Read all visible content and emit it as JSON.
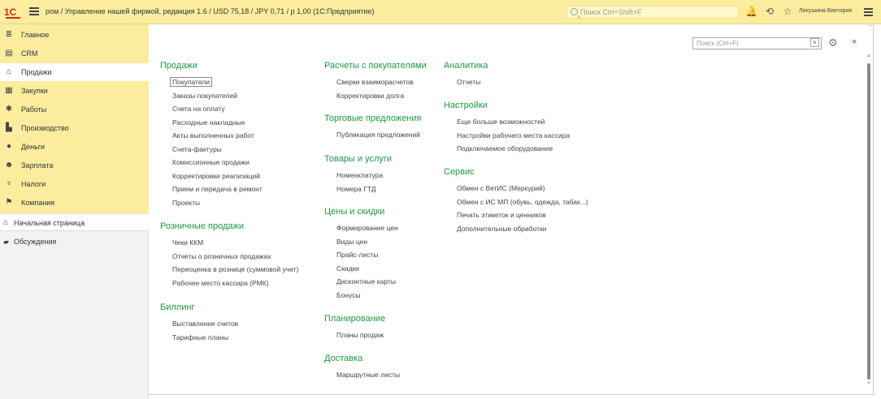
{
  "topbar": {
    "logo": "1С",
    "title": "ром / Управление нашей фирмой, редакция 1.6 / USD 75,18 / JPY 0,71 / р 1,00  (1С:Предприятие)",
    "search_placeholder": "Поиск Ctrl+Shift+F",
    "user": "Лихушина Виктория"
  },
  "sidebar": {
    "items": [
      {
        "label": "Главное",
        "icon": "≣",
        "name": "main"
      },
      {
        "label": "CRM",
        "icon": "▤",
        "name": "crm"
      },
      {
        "label": "Продажи",
        "icon": "⌂",
        "name": "sales"
      },
      {
        "label": "Закупки",
        "icon": "▦",
        "name": "purchases"
      },
      {
        "label": "Работы",
        "icon": "✱",
        "name": "works"
      },
      {
        "label": "Производство",
        "icon": "▙",
        "name": "production"
      },
      {
        "label": "Деньги",
        "icon": "●",
        "name": "money"
      },
      {
        "label": "Зарплата",
        "icon": "☻",
        "name": "salary"
      },
      {
        "label": "Налоги",
        "icon": "♆",
        "name": "taxes"
      },
      {
        "label": "Компания",
        "icon": "⚑",
        "name": "company"
      }
    ],
    "home": "Начальная страница",
    "discussions": "Обсуждения"
  },
  "panel": {
    "search_placeholder": "Поиск (Ctrl+F)",
    "clear": "×",
    "close": "×"
  },
  "sections": {
    "sales": {
      "title": "Продажи",
      "links": [
        "Покупатели",
        "Заказы покупателей",
        "Счета на оплату",
        "Расходные накладные",
        "Акты выполненных работ",
        "Счета-фактуры",
        "Комиссионные продажи",
        "Корректировки реализаций",
        "Прием и передача в ремонт",
        "Проекты"
      ]
    },
    "retail": {
      "title": "Розничные продажи",
      "links": [
        "Чеки ККМ",
        "Отчеты о розничных продажах",
        "Переоценка в рознице (суммовой учет)",
        "Рабочее место кассира (РМК)"
      ]
    },
    "billing": {
      "title": "Биллинг",
      "links": [
        "Выставление счетов",
        "Тарифные планы"
      ]
    },
    "settlements": {
      "title": "Расчеты с покупателями",
      "links": [
        "Сверки взаиморасчетов",
        "Корректировки долга"
      ]
    },
    "offers": {
      "title": "Торговые предложения",
      "links": [
        "Публикация предложений"
      ]
    },
    "goods": {
      "title": "Товары и услуги",
      "links": [
        "Номенклатура",
        "Номера ГТД"
      ]
    },
    "prices": {
      "title": "Цены и скидки",
      "links": [
        "Формирование цен",
        "Виды цен",
        "Прайс-листы",
        "Скидки",
        "Дисконтные карты",
        "Бонусы"
      ]
    },
    "planning": {
      "title": "Планирование",
      "links": [
        "Планы продаж"
      ]
    },
    "delivery": {
      "title": "Доставка",
      "links": [
        "Маршрутные листы"
      ]
    },
    "analytics": {
      "title": "Аналитика",
      "links": [
        "Отчеты"
      ]
    },
    "settings": {
      "title": "Настройки",
      "links": [
        "Еще больше возможностей",
        "Настройки рабочего места кассира",
        "Подключаемое оборудование"
      ]
    },
    "service": {
      "title": "Сервис",
      "links": [
        "Обмен с ВетИС (Меркурий)",
        "Обмен с ИС МП (обувь, одежда, табак...)",
        "Печать этикеток и ценников",
        "Дополнительные обработки"
      ]
    }
  }
}
